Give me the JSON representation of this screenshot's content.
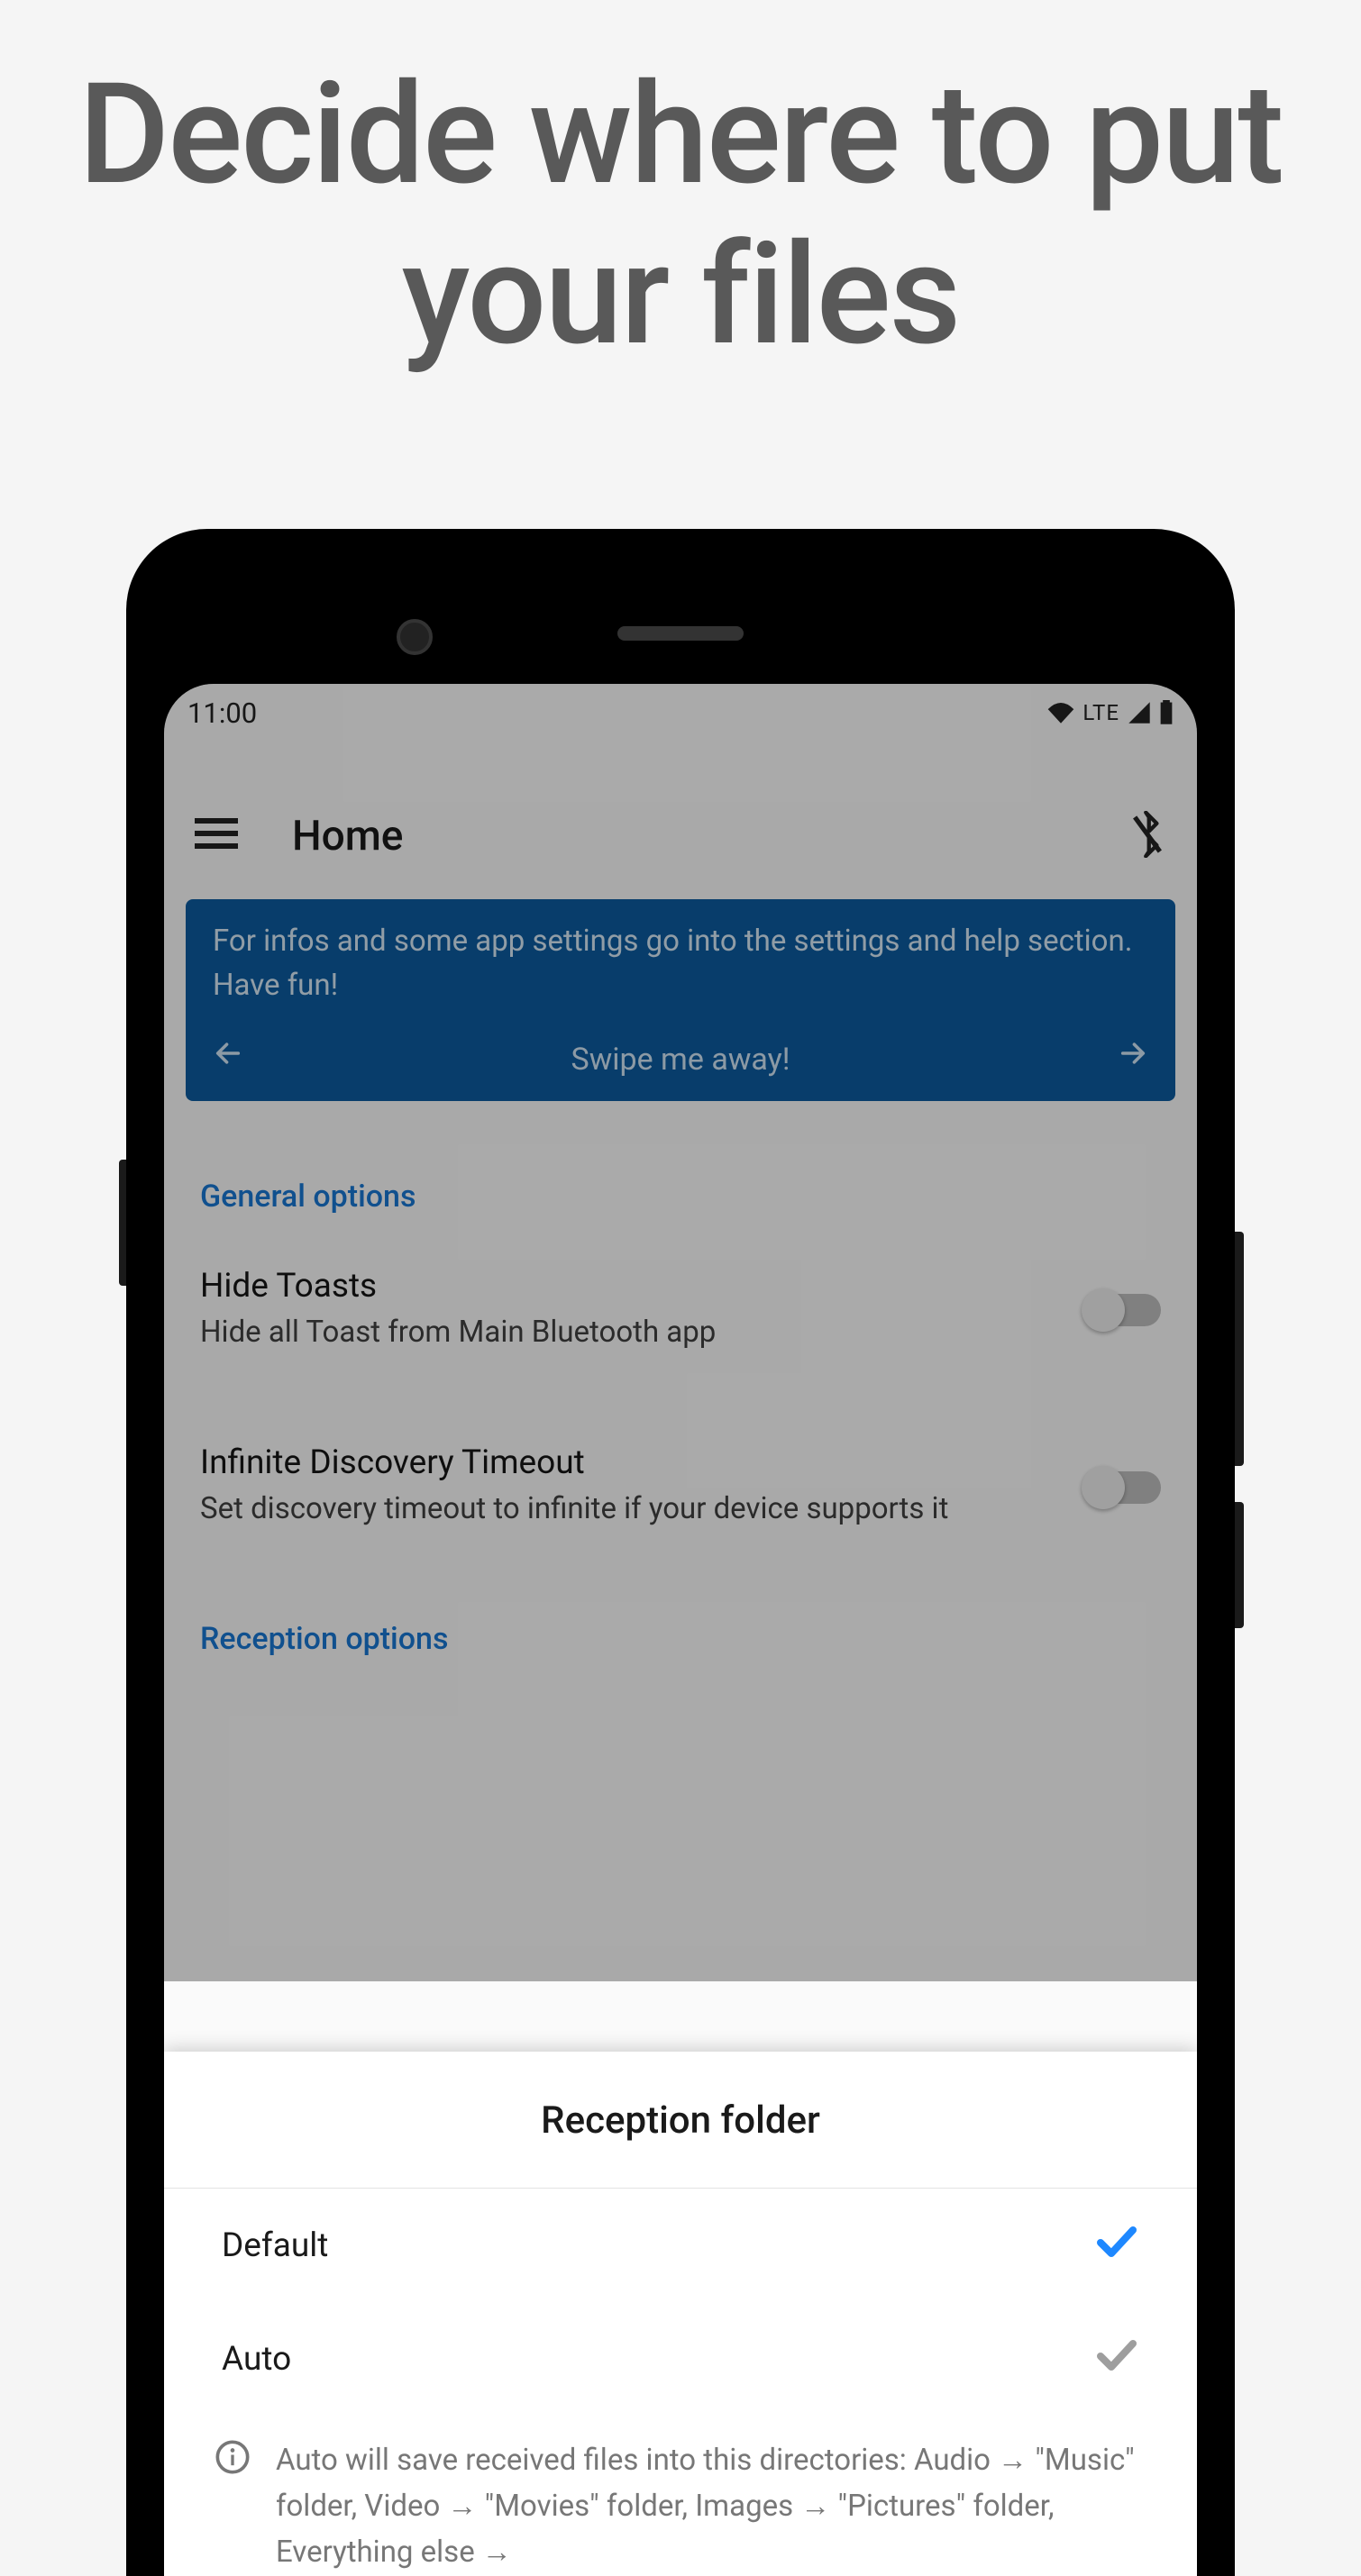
{
  "page_title": "Decide where to put your files",
  "statusbar": {
    "time": "11:00",
    "net": "LTE"
  },
  "appbar": {
    "title": "Home"
  },
  "banner": {
    "line1": "For infos and some app settings go into the settings and help section.",
    "line2": "Have fun!",
    "swipe": "Swipe me away!"
  },
  "sections": {
    "general": "General options",
    "reception": "Reception options"
  },
  "settings": {
    "hide_toasts": {
      "title": "Hide Toasts",
      "sub": "Hide all Toast from Main Bluetooth app"
    },
    "infinite_discovery": {
      "title": "Infinite Discovery Timeout",
      "sub": "Set discovery timeout to infinite if your device supports it"
    }
  },
  "sheet": {
    "title": "Reception folder",
    "options": {
      "default": "Default",
      "auto": "Auto"
    },
    "info": "Auto will save received files into this directories: Audio → \"Music\" folder, Video → \"Movies\" folder, Images → \"Pictures\" folder, Everything else →"
  }
}
